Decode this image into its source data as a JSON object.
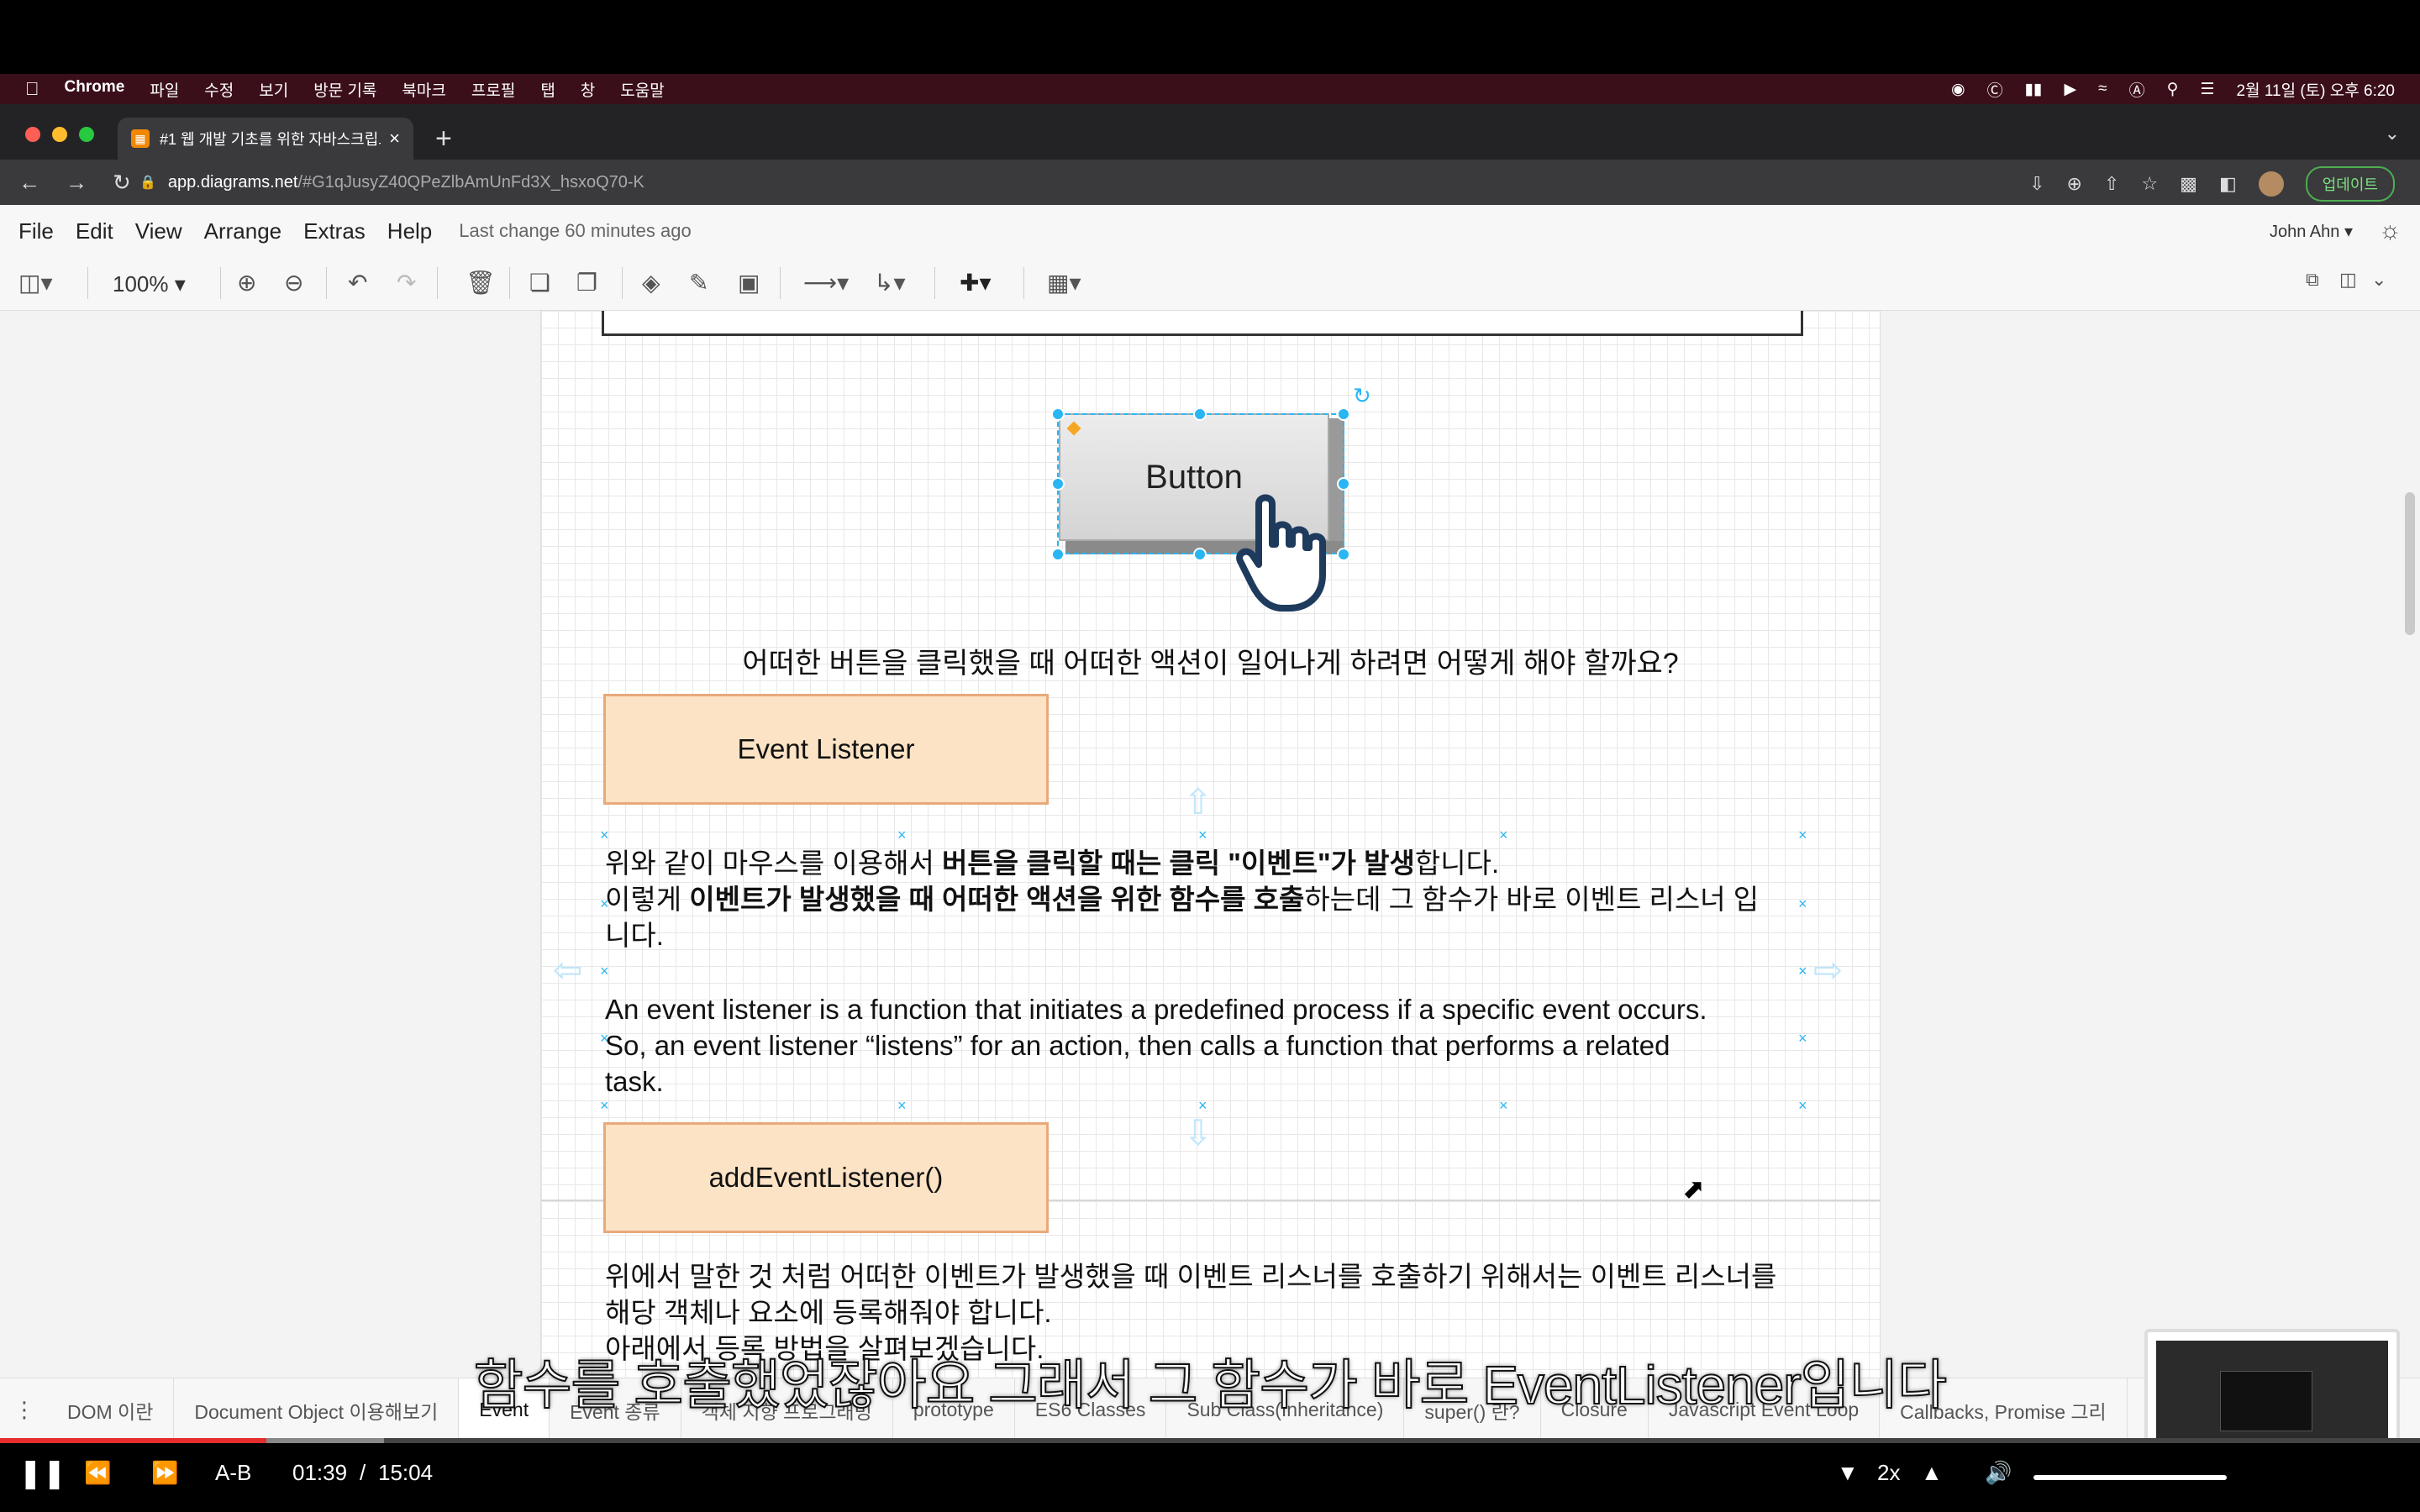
{
  "mac_menu": {
    "app": "Chrome",
    "items": [
      "파일",
      "수정",
      "보기",
      "방문 기록",
      "북마크",
      "프로필",
      "탭",
      "창",
      "도움말"
    ],
    "datetime": "2월 11일 (토) 오후 6:20"
  },
  "browser": {
    "tab_title": "#1 웹 개발 기초를 위한 자바스크립트",
    "url_host": "app.diagrams.net",
    "url_path": "/#G1qJusyZ40QPeZlbAmUnFd3X_hsxoQ70-K",
    "update_label": "업데이트"
  },
  "drawio": {
    "menu": [
      "File",
      "Edit",
      "View",
      "Arrange",
      "Extras",
      "Help"
    ],
    "last_change": "Last change 60 minutes ago",
    "user": "John Ahn",
    "zoom": "100%"
  },
  "diagram": {
    "button_label": "Button",
    "question": "어떠한 버튼을 클릭했을 때 어떠한 액션이 일어나게 하려면 어떻게 해야 할까요?",
    "box1": "Event Listener",
    "ko_para": {
      "l1_a": "위와 같이 마우스를 이용해서 ",
      "l1_b": "버튼을 클릭할 때는 클릭 \"이벤트\"가 발생",
      "l1_c": "합니다.",
      "l2_a": "이렇게 ",
      "l2_b": "이벤트가 발생했을 때 어떠한 액션을 위한 함수를 호출",
      "l2_c": "하는데 그 함수가 바로 이벤트 리스너 입",
      "l3": "니다."
    },
    "en_para": {
      "l1": "An event listener is a function that initiates a predefined process if a specific event occurs.",
      "l2": "So, an event listener “listens” for an action, then calls a function that performs a related",
      "l3": "task."
    },
    "box2": "addEventListener()",
    "ko_para2": {
      "l1": "위에서 말한 것 처럼 어떠한 이벤트가 발생했을 때 이벤트 리스너를 호출하기 위해서는 이벤트 리스너를",
      "l2": "해당 객체나 요소에 등록해줘야 합니다.",
      "l3": "아래에서 등록 방법을 살펴보겠습니다."
    }
  },
  "sheets": [
    "DOM 이란",
    "Document Object 이용해보기",
    "Event",
    "Event 종류",
    "객체 지향 프로그래밍",
    "prototype",
    "ES6 Classes",
    "Sub Class(Inheritance)",
    "super() 란?",
    "Closure",
    "Javascript Event Loop",
    "Callbacks, Promise 그리"
  ],
  "video": {
    "subtitle": "함수를 호출했었잖아요 그래서 그 함수가 바로 EventListener입니다",
    "ab_label": "A-B",
    "time_current": "01:39",
    "time_sep": "/",
    "time_total": "15:04",
    "speed": "2x",
    "progress_fraction": 0.11
  }
}
